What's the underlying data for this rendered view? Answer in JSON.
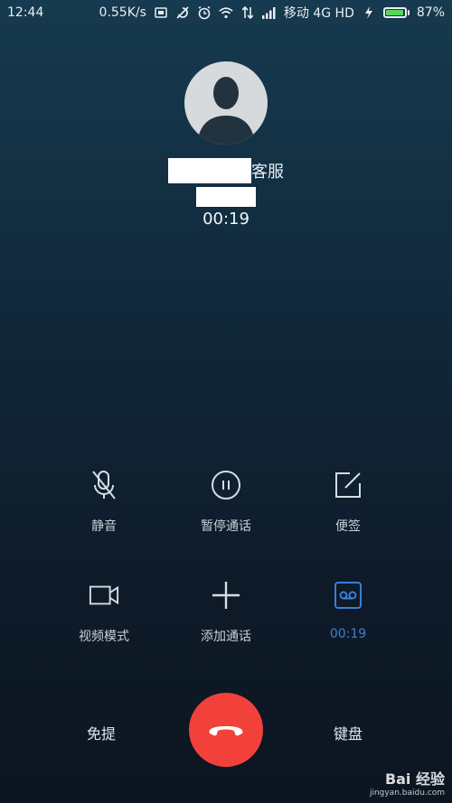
{
  "status_bar": {
    "time": "12:44",
    "speed": "0.55K/s",
    "carrier": "移动 4G HD",
    "battery_percent": "87%",
    "battery_level": 0.87,
    "icons": [
      "sim-card-icon",
      "do-not-disturb-icon",
      "alarm-icon",
      "wifi-icon",
      "data-arrows-icon",
      "signal-icon",
      "charging-icon"
    ]
  },
  "call": {
    "name_suffix": "客服",
    "timer": "00:19"
  },
  "controls": [
    {
      "label": "静音",
      "icon": "mute-mic-icon"
    },
    {
      "label": "暂停通话",
      "icon": "pause-icon"
    },
    {
      "label": "便签",
      "icon": "note-edit-icon"
    },
    {
      "label": "视频模式",
      "icon": "video-camera-icon"
    },
    {
      "label": "添加通话",
      "icon": "add-call-icon"
    },
    {
      "label": "00:19",
      "icon": "recording-icon"
    }
  ],
  "bottom": {
    "speaker_label": "免提",
    "keypad_label": "键盘"
  },
  "watermark": {
    "title": "Bai 经验",
    "sub": "jingyan.baidu.com"
  },
  "colors": {
    "accent": "#3a7fd5",
    "hangup": "#f2413a",
    "battery": "#57d65a"
  }
}
